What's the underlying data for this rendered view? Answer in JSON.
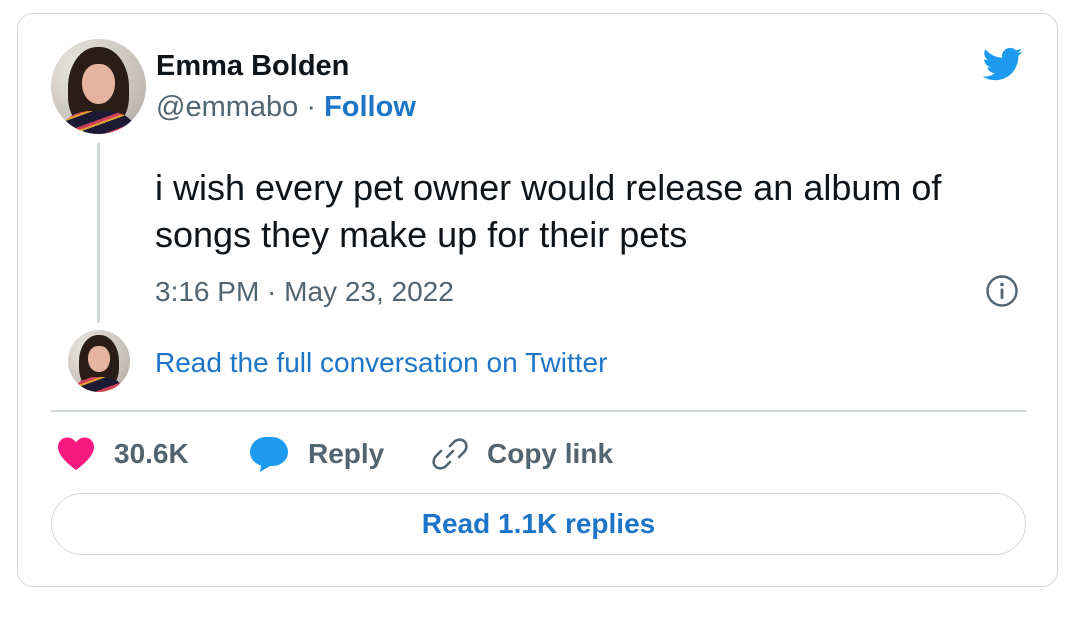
{
  "author": {
    "name": "Emma Bolden",
    "handle": "@emmabo",
    "separator": " · ",
    "follow_label": "Follow"
  },
  "tweet": {
    "text": "i wish every pet owner would release an album of songs they make up for their pets",
    "timestamp": "3:16 PM · May 23, 2022"
  },
  "conversation_link": "Read the full conversation on Twitter",
  "actions": {
    "likes_count": "30.6K",
    "reply_label": "Reply",
    "copy_link_label": "Copy link"
  },
  "read_replies_label": "Read 1.1K replies",
  "icons": {
    "brand": "twitter-bird-icon",
    "info": "info-icon",
    "like": "heart-icon",
    "reply": "speech-bubble-icon",
    "copy": "link-icon"
  },
  "colors": {
    "brand_blue": "#1d9bf0",
    "link_blue": "#1d75c8",
    "like_pink": "#f91880",
    "text_primary": "#0f1419",
    "text_secondary": "#536471",
    "border": "#cfd9de"
  }
}
